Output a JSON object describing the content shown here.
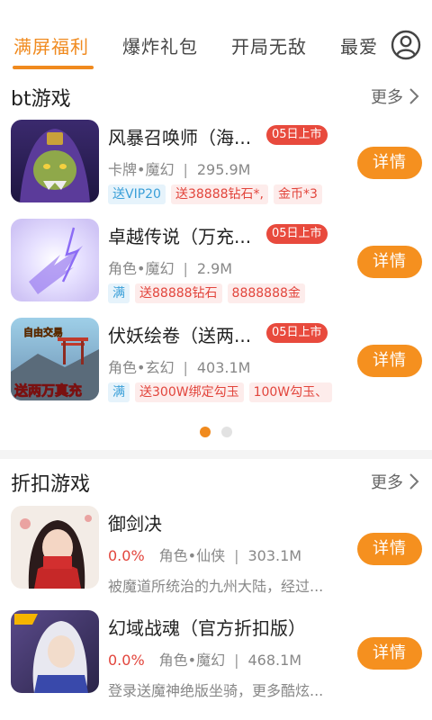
{
  "tabs": [
    {
      "label": "满屏福利",
      "active": true
    },
    {
      "label": "爆炸礼包",
      "active": false
    },
    {
      "label": "开局无敌",
      "active": false
    },
    {
      "label": "最爱",
      "active": false
    }
  ],
  "bt_section": {
    "title": "bt游戏",
    "more": "更多",
    "games": [
      {
        "name": "风暴召唤师（海...",
        "release": "05日上市",
        "category": "卡牌•魔幻",
        "size": "295.9M",
        "tags": [
          {
            "text": "送VIP20",
            "color": "blue"
          },
          {
            "text": "送38888钻石*,",
            "color": "red"
          },
          {
            "text": "金币*3",
            "color": "red"
          }
        ],
        "button": "详情"
      },
      {
        "name": "卓越传说（万充...",
        "release": "05日上市",
        "category": "角色•魔幻",
        "size": "2.9M",
        "tags": [
          {
            "text": "满",
            "color": "blue"
          },
          {
            "text": "送88888钻石",
            "color": "red"
          },
          {
            "text": "8888888金",
            "color": "red"
          }
        ],
        "button": "详情"
      },
      {
        "name": "伏妖绘卷（送两...",
        "release": "05日上市",
        "category": "角色•玄幻",
        "size": "403.1M",
        "tags": [
          {
            "text": "满",
            "color": "blue"
          },
          {
            "text": "送300W绑定勾玉",
            "color": "red"
          },
          {
            "text": "100W勾玉、",
            "color": "red"
          }
        ],
        "button": "详情",
        "thumb_text": {
          "top": "自由交易",
          "bottom": "送两万真充"
        }
      }
    ],
    "pager": {
      "pages": 2,
      "current": 1
    }
  },
  "discount_section": {
    "title": "折扣游戏",
    "more": "更多",
    "games": [
      {
        "name": "御剑决",
        "discount": "0.0%",
        "category": "角色•仙侠",
        "size": "303.1M",
        "desc": "被魔道所统治的九州大陆，经过...",
        "button": "详情"
      },
      {
        "name": "幻域战魂（官方折扣版）",
        "discount": "0.0%",
        "category": "角色•魔幻",
        "size": "468.1M",
        "desc": "登录送魔神绝版坐骑，更多酷炫...",
        "button": "详情"
      }
    ]
  },
  "colors": {
    "accent": "#f08a1e",
    "release_badge": "#e84a3d",
    "discount": "#e2453c"
  }
}
